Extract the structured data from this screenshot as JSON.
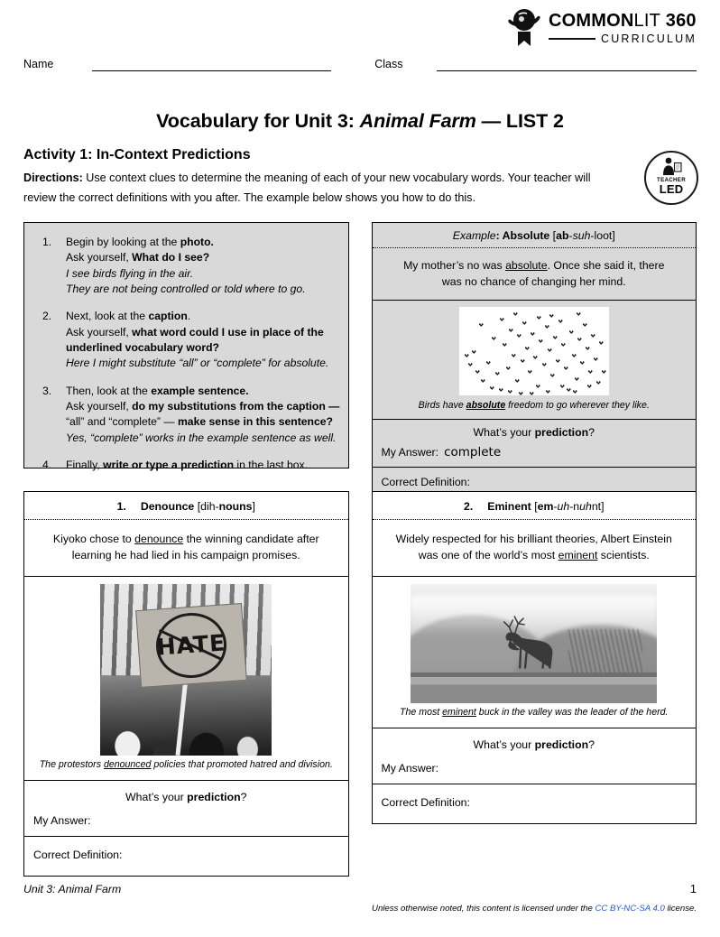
{
  "logo": {
    "line1_bold": "COMMON",
    "line1_thin": "LIT",
    "line1_num": " 360",
    "line2": "CURRICULUM"
  },
  "identity": {
    "name_label": "Name",
    "class_label": "Class"
  },
  "header": {
    "title_prefix": "Vocabulary for Unit 3: ",
    "title_italic": "Animal Farm",
    "title_suffix": " — LIST 2",
    "activity": "Activity 1: In-Context Predictions",
    "directions_label": "Directions:",
    "directions_text": " Use context clues to determine the meaning of each of your new vocabulary words. Your teacher will review the correct definitions with you after. The example below shows you how to do this."
  },
  "badge": {
    "line1": "TEACHER",
    "line2": "LED",
    "icon": "teacher-led-icon"
  },
  "instructions": [
    {
      "num": "1.",
      "lines": [
        {
          "parts": [
            {
              "t": "Begin by looking at the ",
              "s": "n"
            },
            {
              "t": "photo.",
              "s": "b"
            }
          ]
        },
        {
          "parts": [
            {
              "t": "Ask yourself, ",
              "s": "n"
            },
            {
              "t": "What do I see?",
              "s": "b"
            }
          ]
        },
        {
          "parts": [
            {
              "t": "I see birds flying in the air.",
              "s": "i"
            }
          ]
        },
        {
          "parts": [
            {
              "t": "They are not being controlled or told where to go.",
              "s": "i"
            }
          ]
        }
      ]
    },
    {
      "num": "2.",
      "lines": [
        {
          "parts": [
            {
              "t": "Next, look at the ",
              "s": "n"
            },
            {
              "t": "caption",
              "s": "b"
            },
            {
              "t": ".",
              "s": "n"
            }
          ]
        },
        {
          "parts": [
            {
              "t": "Ask yourself, ",
              "s": "n"
            },
            {
              "t": "what word could I use in place of the",
              "s": "b"
            }
          ]
        },
        {
          "parts": [
            {
              "t": "underlined vocabulary word?",
              "s": "b"
            }
          ]
        },
        {
          "parts": [
            {
              "t": "Here I might substitute “all” or “complete” for absolute.",
              "s": "i"
            }
          ]
        }
      ]
    },
    {
      "num": "3.",
      "lines": [
        {
          "parts": [
            {
              "t": "Then, look at the ",
              "s": "n"
            },
            {
              "t": "example sentence.",
              "s": "b"
            }
          ]
        },
        {
          "parts": [
            {
              "t": "Ask yourself, ",
              "s": "n"
            },
            {
              "t": "do my substitutions from the caption —",
              "s": "b"
            }
          ]
        },
        {
          "parts": [
            {
              "t": "“all” and “complete” — ",
              "s": "n"
            },
            {
              "t": "make sense in this sentence?",
              "s": "b"
            }
          ]
        },
        {
          "parts": [
            {
              "t": "Yes, “complete” works in the example sentence as well.",
              "s": "i"
            }
          ]
        }
      ]
    },
    {
      "num": "4.",
      "lines": [
        {
          "parts": [
            {
              "t": "Finally, ",
              "s": "n"
            },
            {
              "t": "write or type a prediction",
              "s": "b"
            },
            {
              "t": " in the last box.",
              "s": "n"
            }
          ]
        }
      ]
    }
  ],
  "example_card": {
    "head_label": "Example",
    "head_word": "Absolute",
    "head_pron_open": " [",
    "head_pron": [
      {
        "t": "ab",
        "s": "b"
      },
      {
        "t": "-",
        "s": "n"
      },
      {
        "t": "suh",
        "s": "i"
      },
      {
        "t": "-loot]",
        "s": "n"
      }
    ],
    "sentence_pre": "My mother’s no was ",
    "sentence_word": "absolute",
    "sentence_post": ". Once she said it, there was no chance of changing her mind.",
    "image": "birds-photo",
    "caption_pre": "Birds have ",
    "caption_word": "absolute",
    "caption_post": " freedom to go wherever they like.",
    "prediction_q_pre": "What’s your ",
    "prediction_q_bold": "prediction",
    "prediction_q_post": "?",
    "answer_label": "My Answer:",
    "answer_value": "complete",
    "definition_label": "Correct Definition:"
  },
  "vocab_cards": [
    {
      "index": "1.",
      "word": "Denounce",
      "pron": [
        {
          "t": "[dih-",
          "s": "n"
        },
        {
          "t": "nouns",
          "s": "b"
        },
        {
          "t": "]",
          "s": "n"
        }
      ],
      "sentence_pre": "Kiyoko chose to ",
      "sentence_word": "denounce",
      "sentence_post": " the winning candidate after learning he had lied in his campaign promises.",
      "image": "protest-photo",
      "caption_pre": "The protestors ",
      "caption_word": "denounced",
      "caption_post": " policies that promoted hatred and division.",
      "prediction_q_pre": "What’s your ",
      "prediction_q_bold": "prediction",
      "prediction_q_post": "?",
      "answer_label": "My Answer:",
      "answer_value": "",
      "definition_label": "Correct Definition:"
    },
    {
      "index": "2.",
      "word": "Eminent",
      "pron": [
        {
          "t": "[",
          "s": "n"
        },
        {
          "t": "em",
          "s": "b"
        },
        {
          "t": "-",
          "s": "n"
        },
        {
          "t": "uh",
          "s": "i"
        },
        {
          "t": "-n",
          "s": "n"
        },
        {
          "t": "uh",
          "s": "i"
        },
        {
          "t": "nt]",
          "s": "n"
        }
      ],
      "sentence_pre": "Widely respected for his brilliant theories, Albert Einstein was one of the world’s most ",
      "sentence_word": "eminent",
      "sentence_post": " scientists.",
      "image": "deer-photo",
      "caption_pre": "The most ",
      "caption_word": "eminent",
      "caption_post": " buck in the valley was the leader of the herd.",
      "prediction_q_pre": "What’s your ",
      "prediction_q_bold": "prediction",
      "prediction_q_post": "?",
      "answer_label": "My Answer:",
      "answer_value": "",
      "definition_label": "Correct Definition:"
    }
  ],
  "footer": {
    "unit": "Unit 3: Animal Farm",
    "page_number": "1",
    "license_pre": "Unless otherwise noted, this content is licensed under the ",
    "license_link": "CC BY-NC-SA 4.0",
    "license_post": " license.",
    "link_color": "#2457d6"
  }
}
